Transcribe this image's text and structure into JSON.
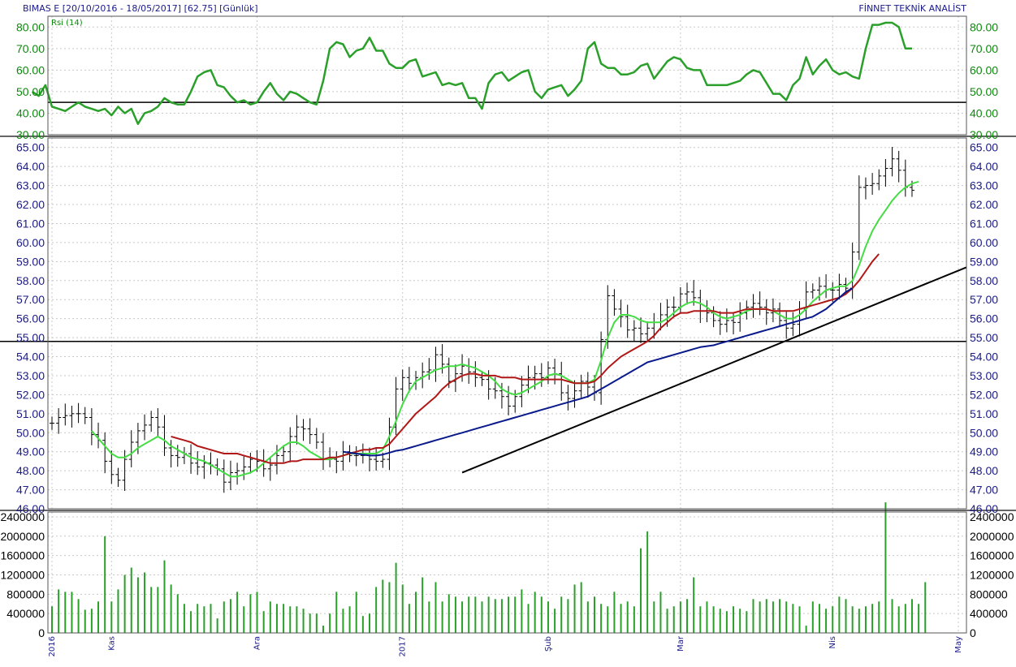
{
  "header": {
    "left": "BIMAS E [20/10/2016 - 18/05/2017] [62.75] [Günlük]",
    "right": "FİNNET TEKNİK ANALİST"
  },
  "colors": {
    "rsi": "#2aa02a",
    "ma_fast": "#44dd44",
    "ma_mid": "#b01818",
    "ma_slow": "#0a1a8c",
    "volume": "#2aa02a",
    "axis_text_green": "#0a8a0a",
    "axis_text_blue": "#1a1a8c",
    "grid": "#c8c8c8"
  },
  "chart_data": [
    {
      "type": "line",
      "panel": "rsi",
      "legend": "Rsi (14)",
      "ylim": [
        30,
        85
      ],
      "yticks": [
        "30.00",
        "40.00",
        "50.00",
        "60.00",
        "70.00",
        "80.00"
      ],
      "hline": 45,
      "series": [
        {
          "name": "Rsi (14)",
          "values": [
            50,
            48,
            53,
            43,
            42,
            41,
            43,
            45,
            43,
            42,
            41,
            42,
            39,
            43,
            40,
            42,
            35,
            40,
            41,
            43,
            47,
            45,
            44,
            44,
            50,
            57,
            59,
            60,
            53,
            52,
            48,
            45,
            46,
            44,
            45,
            50,
            54,
            49,
            46,
            50,
            49,
            47,
            45,
            44,
            55,
            70,
            73,
            72,
            66,
            69,
            70,
            75,
            69,
            69,
            63,
            61,
            61,
            64,
            65,
            57,
            58,
            59,
            53,
            54,
            53,
            54,
            47,
            47,
            42,
            54,
            58,
            59,
            55,
            57,
            59,
            60,
            50,
            47,
            51,
            52,
            53,
            48,
            51,
            55,
            70,
            73,
            63,
            61,
            61,
            58,
            58,
            59,
            62,
            63,
            56,
            60,
            64,
            66,
            65,
            61,
            60,
            60,
            53,
            53,
            53,
            53,
            54,
            55,
            58,
            60,
            59,
            54,
            49,
            49,
            46,
            53,
            56,
            66,
            58,
            62,
            65,
            60,
            58,
            59,
            57,
            56,
            70,
            81,
            81,
            82,
            82,
            80,
            70,
            70
          ]
        }
      ]
    },
    {
      "type": "ohlc",
      "panel": "price",
      "ylim": [
        46,
        65.5
      ],
      "yticks": [
        "46.00",
        "47.00",
        "48.00",
        "49.00",
        "50.00",
        "51.00",
        "52.00",
        "53.00",
        "54.00",
        "55.00",
        "56.00",
        "57.00",
        "58.00",
        "59.00",
        "60.00",
        "61.00",
        "62.00",
        "63.00",
        "64.00",
        "65.00"
      ],
      "hline": 54.8,
      "trendline": {
        "x": [
          62,
          134
        ],
        "y": [
          47.9,
          58.1
        ]
      },
      "series": [
        {
          "name": "close",
          "values": [
            50.5,
            50.8,
            50.9,
            51,
            51,
            50.8,
            49.9,
            49.6,
            48.5,
            47.8,
            47.5,
            48.6,
            49.5,
            50.1,
            50.4,
            50.8,
            50.3,
            49.2,
            48.8,
            48.7,
            48.9,
            48.4,
            48.2,
            48.4,
            48.3,
            48.1,
            47.4,
            47.9,
            48,
            48.2,
            48.6,
            48.5,
            48.1,
            48.3,
            48.8,
            49,
            49.8,
            50.3,
            50.2,
            49.9,
            49.5,
            48.6,
            48.6,
            48.5,
            49,
            48.8,
            48.8,
            48.8,
            48.6,
            48.5,
            48.6,
            50.3,
            52.3,
            52.9,
            52.6,
            52.9,
            53.2,
            53.3,
            54.1,
            53.6,
            52.7,
            53.1,
            53.5,
            53.2,
            52.9,
            52.8,
            52.3,
            52.2,
            51.9,
            51.4,
            51.9,
            52.5,
            52.9,
            53.1,
            52.9,
            53.4,
            53.1,
            52.1,
            51.8,
            52.2,
            52.7,
            52.4,
            52.1,
            54.9,
            57.2,
            56.5,
            56.1,
            55.4,
            55.5,
            55.2,
            55.5,
            55.8,
            56.2,
            56.6,
            56.6,
            57.3,
            57.4,
            57.1,
            56.4,
            56.3,
            55.9,
            55.7,
            55.9,
            55.8,
            56.3,
            56.6,
            56.8,
            56.6,
            56.3,
            56.5,
            55.9,
            55.5,
            55.7,
            56.5,
            57.4,
            57.5,
            57.7,
            57.5,
            57.5,
            57.8,
            57.6,
            59.5,
            62.9,
            63,
            63.1,
            63.5,
            63.9,
            64.4,
            63.8,
            62.9,
            62.75
          ]
        },
        {
          "name": "MA fast",
          "values": [
            null,
            null,
            null,
            null,
            null,
            null,
            50.1,
            49.7,
            49.3,
            48.9,
            48.7,
            48.7,
            48.9,
            49.2,
            49.4,
            49.6,
            49.8,
            49.6,
            49.3,
            49.1,
            48.9,
            48.7,
            48.6,
            48.5,
            48.3,
            48.1,
            47.9,
            47.7,
            47.7,
            47.8,
            47.9,
            48.1,
            48.4,
            48.7,
            49,
            49.3,
            49.5,
            49.5,
            49.3,
            49,
            48.8,
            48.6,
            48.6,
            48.7,
            48.8,
            48.9,
            48.9,
            48.9,
            48.9,
            48.9,
            49.1,
            49.8,
            50.6,
            51.5,
            52.2,
            52.7,
            52.9,
            53.1,
            53.3,
            53.4,
            53.5,
            53.5,
            53.6,
            53.5,
            53.4,
            53.2,
            53,
            52.7,
            52.3,
            52.1,
            52,
            52.1,
            52.3,
            52.5,
            52.7,
            53,
            53.1,
            53,
            52.8,
            52.6,
            52.6,
            52.6,
            52.8,
            53.8,
            55,
            55.8,
            56.2,
            56.2,
            56.1,
            55.9,
            55.8,
            55.8,
            55.8,
            56,
            56.3,
            56.6,
            56.8,
            56.9,
            56.8,
            56.6,
            56.3,
            56.1,
            56,
            56.1,
            56.2,
            56.4,
            56.5,
            56.5,
            56.5,
            56.4,
            56.2,
            56,
            56,
            56.2,
            56.5,
            56.9,
            57.2,
            57.5,
            57.6,
            57.7,
            57.7,
            58,
            58.8,
            59.8,
            60.6,
            61.2,
            61.7,
            62.2,
            62.6,
            62.9,
            63.1,
            63.2
          ]
        },
        {
          "name": "MA mid",
          "values": [
            null,
            null,
            null,
            null,
            null,
            null,
            null,
            null,
            null,
            null,
            null,
            null,
            null,
            null,
            null,
            null,
            null,
            null,
            49.8,
            49.7,
            49.6,
            49.5,
            49.3,
            49.2,
            49.1,
            49,
            48.9,
            48.9,
            48.9,
            48.8,
            48.7,
            48.6,
            48.5,
            48.4,
            48.4,
            48.4,
            48.5,
            48.5,
            48.6,
            48.6,
            48.6,
            48.6,
            48.7,
            48.7,
            48.8,
            48.9,
            49,
            49.1,
            49.1,
            49.2,
            49.2,
            49.4,
            49.8,
            50.2,
            50.6,
            51,
            51.3,
            51.6,
            51.9,
            52.3,
            52.6,
            52.8,
            53,
            53.1,
            53.1,
            53,
            53,
            53,
            52.9,
            52.9,
            52.9,
            52.8,
            52.8,
            52.8,
            52.8,
            52.8,
            52.8,
            52.8,
            52.7,
            52.6,
            52.6,
            52.6,
            52.7,
            53,
            53.4,
            53.7,
            54,
            54.2,
            54.4,
            54.6,
            54.8,
            55.1,
            55.5,
            55.8,
            56.1,
            56.3,
            56.3,
            56.4,
            56.4,
            56.4,
            56.4,
            56.3,
            56.3,
            56.3,
            56.4,
            56.5,
            56.5,
            56.5,
            56.5,
            56.4,
            56.4,
            56.4,
            56.4,
            56.5,
            56.6,
            56.7,
            56.8,
            56.9,
            57,
            57.1,
            57.3,
            57.6,
            58,
            58.5,
            59,
            59.4
          ]
        },
        {
          "name": "MA slow",
          "values": [
            null,
            null,
            null,
            null,
            null,
            null,
            null,
            null,
            null,
            null,
            null,
            null,
            null,
            null,
            null,
            null,
            null,
            null,
            null,
            null,
            null,
            null,
            null,
            null,
            null,
            null,
            null,
            null,
            null,
            null,
            null,
            null,
            null,
            null,
            null,
            null,
            null,
            null,
            null,
            null,
            null,
            null,
            null,
            null,
            49,
            48.95,
            48.9,
            48.85,
            48.8,
            48.8,
            48.85,
            48.95,
            49.05,
            49.1,
            49.2,
            49.3,
            49.4,
            49.5,
            49.6,
            49.7,
            49.8,
            49.9,
            50,
            50.1,
            50.2,
            50.3,
            50.4,
            50.5,
            50.6,
            50.7,
            50.8,
            50.9,
            51,
            51.1,
            51.2,
            51.3,
            51.4,
            51.5,
            51.6,
            51.7,
            51.8,
            51.9,
            52.1,
            52.3,
            52.5,
            52.7,
            52.9,
            53.1,
            53.3,
            53.5,
            53.7,
            53.8,
            53.9,
            54,
            54.1,
            54.2,
            54.3,
            54.4,
            54.5,
            54.55,
            54.6,
            54.7,
            54.8,
            54.9,
            55,
            55.1,
            55.2,
            55.3,
            55.4,
            55.5,
            55.6,
            55.7,
            55.8,
            55.9,
            56,
            56.1,
            56.3,
            56.5,
            56.8,
            57.1,
            57.4,
            57.6
          ]
        }
      ]
    },
    {
      "type": "bar",
      "panel": "volume",
      "ylim": [
        0,
        2500000
      ],
      "yticks_left": [
        "0",
        "400000",
        "800000",
        "1200000",
        "1600000",
        "2000000",
        "2400000"
      ],
      "yticks_right": [
        "0",
        "400000",
        "800000",
        "1200000",
        "1600000",
        "2000000",
        "2400000"
      ],
      "series": [
        {
          "name": "volume",
          "values": [
            550000,
            900000,
            850000,
            850000,
            700000,
            480000,
            500000,
            650000,
            2000000,
            650000,
            900000,
            1200000,
            1350000,
            1150000,
            1250000,
            950000,
            950000,
            1500000,
            1000000,
            800000,
            600000,
            450000,
            600000,
            550000,
            600000,
            300000,
            650000,
            700000,
            850000,
            550000,
            800000,
            850000,
            450000,
            650000,
            600000,
            600000,
            550000,
            550000,
            500000,
            400000,
            400000,
            150000,
            400000,
            850000,
            500000,
            550000,
            850000,
            350000,
            400000,
            950000,
            1100000,
            1050000,
            1450000,
            1000000,
            600000,
            850000,
            1150000,
            650000,
            1050000,
            650000,
            800000,
            750000,
            650000,
            750000,
            750000,
            650000,
            750000,
            700000,
            700000,
            750000,
            750000,
            900000,
            600000,
            850000,
            750000,
            650000,
            500000,
            750000,
            700000,
            1000000,
            1050000,
            650000,
            750000,
            600000,
            550000,
            850000,
            600000,
            650000,
            550000,
            1750000,
            2100000,
            650000,
            850000,
            500000,
            550000,
            650000,
            700000,
            1150000,
            550000,
            650000,
            550000,
            500000,
            450000,
            550000,
            500000,
            450000,
            700000,
            650000,
            700000,
            650000,
            700000,
            650000,
            600000,
            550000,
            150000,
            650000,
            600000,
            500000,
            550000,
            750000,
            700000,
            550000,
            500000,
            550000,
            600000,
            650000,
            2700000,
            700000,
            550000,
            600000,
            700000,
            600000,
            1050000
          ]
        }
      ]
    }
  ],
  "xaxis": {
    "labels": [
      {
        "text": "2016",
        "i": 0
      },
      {
        "text": "Kas",
        "i": 9
      },
      {
        "text": "Ara",
        "i": 31
      },
      {
        "text": "2017",
        "i": 53
      },
      {
        "text": "Şub",
        "i": 75
      },
      {
        "text": "Mar",
        "i": 95
      },
      {
        "text": "Nis",
        "i": 118
      },
      {
        "text": "May",
        "i": 137
      }
    ]
  }
}
